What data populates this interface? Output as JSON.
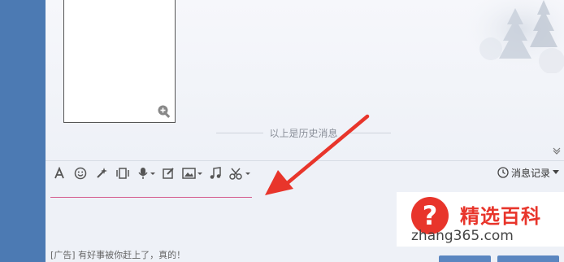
{
  "chat": {
    "history_divider_text": "以上是历史消息"
  },
  "toolbar": {
    "font_icon": "font-icon",
    "emoji_icon": "smiley-icon",
    "history_label": "消息记录"
  },
  "input": {
    "ad_text": "[广告] 有好事被你赶上了，真的！"
  },
  "watermark": {
    "title": "精选百科",
    "url": "zhang365.com",
    "symbol": "?"
  },
  "colors": {
    "sidebar": "#4c7ab3",
    "arrow": "#e8352b",
    "input_underline": "#d45a8c"
  }
}
